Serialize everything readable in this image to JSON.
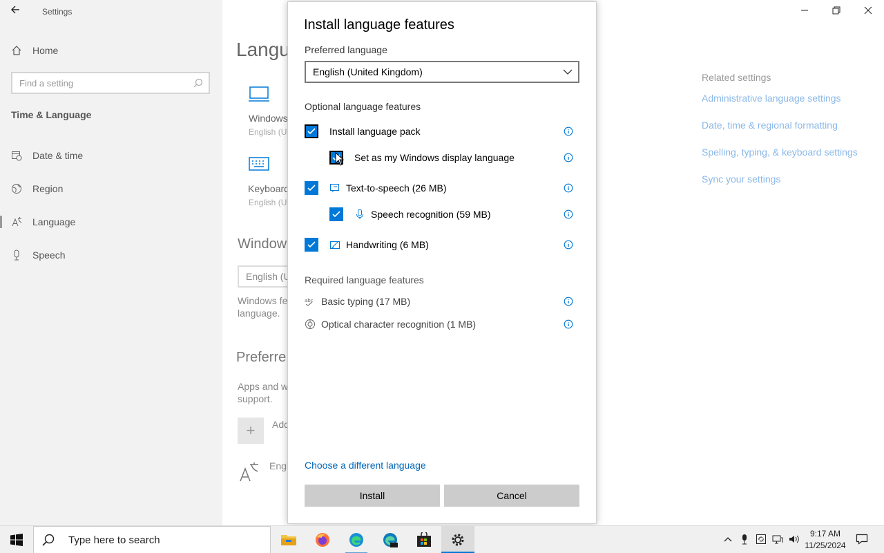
{
  "app": {
    "title": "Settings"
  },
  "nav": {
    "home_label": "Home",
    "search_placeholder": "Find a setting",
    "section_title": "Time & Language",
    "items": [
      {
        "label": "Date & time",
        "icon": "calendar-clock-icon"
      },
      {
        "label": "Region",
        "icon": "globe-icon"
      },
      {
        "label": "Language",
        "icon": "language-icon",
        "active": true
      },
      {
        "label": "Speech",
        "icon": "microphone-icon"
      }
    ]
  },
  "content": {
    "page_title": "Langu",
    "tile1_title": "Windows",
    "tile1_sub": "English (U",
    "tile2_title": "Keyboard",
    "tile2_sub": "English (U",
    "section2_title": "Window",
    "display_lang_value": "English (U",
    "display_desc_line1": "Windows fe",
    "display_desc_line2": "language.",
    "preferred_title": "Preferre",
    "preferred_desc_line1": "Apps and w",
    "preferred_desc_line2": "support.",
    "add_label": "Add",
    "lang_item": "Engl"
  },
  "related": {
    "heading": "Related settings",
    "links": [
      "Administrative language settings",
      "Date, time & regional formatting",
      "Spelling, typing, & keyboard settings",
      "Sync your settings"
    ]
  },
  "dialog": {
    "title": "Install language features",
    "preferred_label": "Preferred language",
    "preferred_value": "English (United Kingdom)",
    "optional_label": "Optional language features",
    "optional": [
      {
        "label": "Install language pack",
        "checked": true,
        "icon": ""
      },
      {
        "label": "Set as my Windows display language",
        "checked": true,
        "icon": ""
      },
      {
        "label": "Text-to-speech (26 MB)",
        "checked": true,
        "icon": "text-to-speech-icon"
      },
      {
        "label": "Speech recognition (59 MB)",
        "checked": true,
        "icon": "microphone-icon"
      },
      {
        "label": "Handwriting (6 MB)",
        "checked": true,
        "icon": "pen-icon"
      }
    ],
    "required_label": "Required language features",
    "required": [
      {
        "label": "Basic typing (17 MB)",
        "icon": "abc-typing-icon"
      },
      {
        "label": "Optical character recognition (1 MB)",
        "icon": "ocr-icon"
      }
    ],
    "link_label": "Choose a different language",
    "install_label": "Install",
    "cancel_label": "Cancel"
  },
  "taskbar": {
    "search_text": "Type here to search",
    "time": "9:17 AM",
    "date": "11/25/2024",
    "apps": [
      "file-explorer-icon",
      "firefox-icon",
      "edge-icon",
      "edge-dev-icon",
      "store-icon",
      "settings-icon"
    ]
  },
  "colors": {
    "accent": "#0078d7",
    "link": "#0067b8",
    "related_link": "#8ab8e8"
  }
}
